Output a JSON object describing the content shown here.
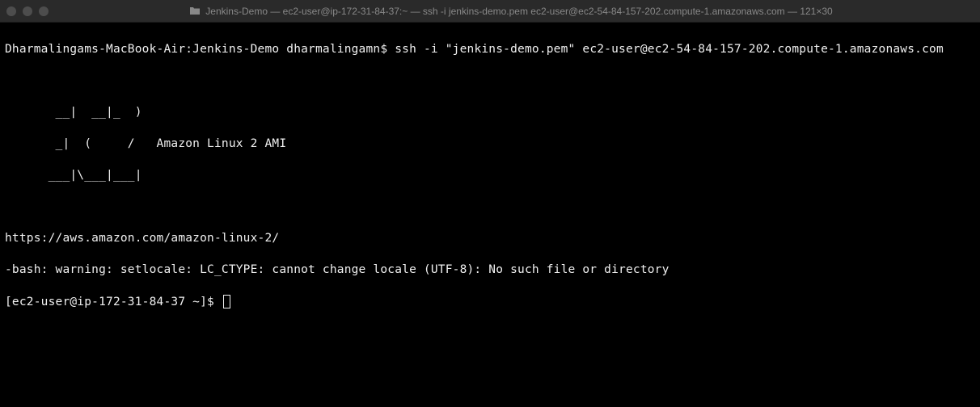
{
  "titlebar": {
    "title": "Jenkins-Demo — ec2-user@ip-172-31-84-37:~ — ssh -i jenkins-demo.pem ec2-user@ec2-54-84-157-202.compute-1.amazonaws.com — 121×30"
  },
  "terminal": {
    "local_prompt": "Dharmalingams-MacBook-Air:Jenkins-Demo dharmalingamn$ ",
    "ssh_command": "ssh -i \"jenkins-demo.pem\" ec2-user@ec2-54-84-157-202.compute-1.amazonaws.com",
    "ascii_art_line1": "       __|  __|_  )",
    "ascii_art_line2": "       _|  (     /   Amazon Linux 2 AMI",
    "ascii_art_line3": "      ___|\\___|___|",
    "url_line": "https://aws.amazon.com/amazon-linux-2/",
    "warning_line": "-bash: warning: setlocale: LC_CTYPE: cannot change locale (UTF-8): No such file or directory",
    "remote_prompt": "[ec2-user@ip-172-31-84-37 ~]$ "
  }
}
